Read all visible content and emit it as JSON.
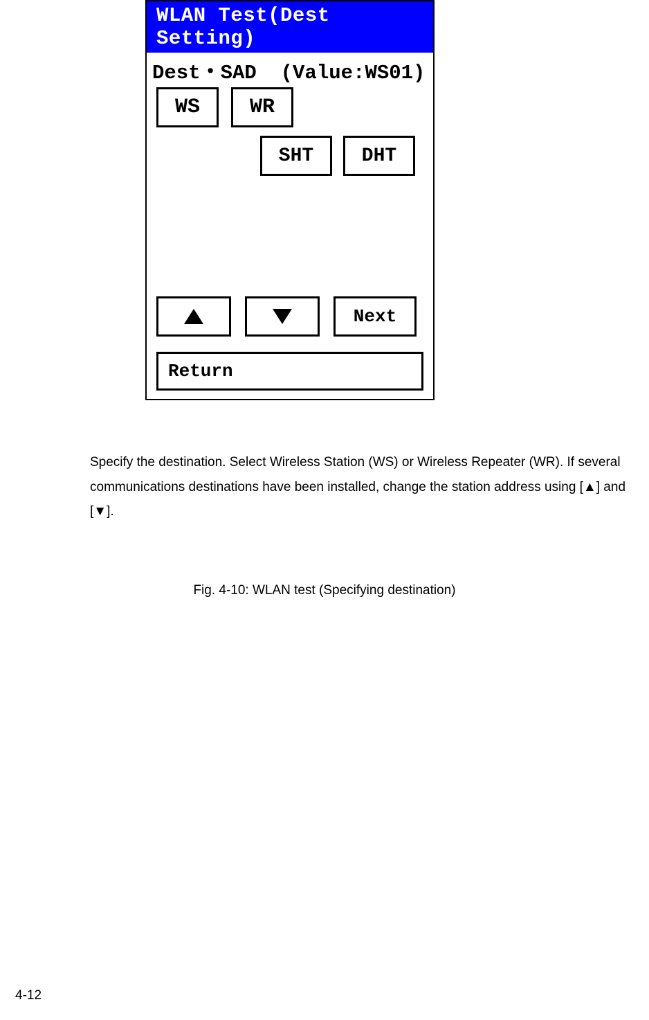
{
  "panel": {
    "title": "WLAN Test(Dest Setting)",
    "dest_line": "Dest・SAD  (Value:WS01)",
    "buttons": {
      "ws": "WS",
      "wr": "WR",
      "sht": "SHT",
      "dht": "DHT",
      "next": "Next",
      "return": "Return"
    }
  },
  "body": {
    "instructions": "Specify the destination. Select Wireless Station (WS) or Wireless Repeater (WR). If several communications destinations have been installed, change the station address using [▲] and [▼].",
    "caption": "Fig. 4-10: WLAN test (Specifying destination)",
    "page_number": "4-12"
  }
}
